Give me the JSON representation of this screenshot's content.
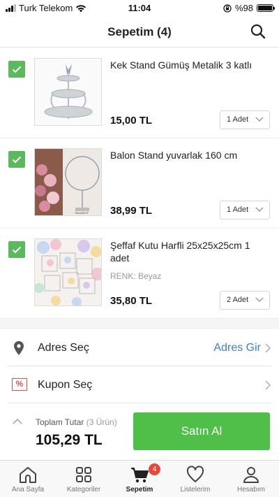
{
  "status_bar": {
    "carrier": "Turk Telekom",
    "time": "11:04",
    "battery": "%98",
    "battery_level": 0.98
  },
  "header": {
    "title": "Sepetim (4)",
    "search_icon": "search-icon"
  },
  "cart": {
    "items": [
      {
        "title": "Kek Stand Gümüş Metalik 3 katlı",
        "variant": "",
        "price": "15,00 TL",
        "quantity": "1 Adet",
        "checked": true
      },
      {
        "title": "Balon Stand yuvarlak 160 cm",
        "variant": "",
        "price": "38,99 TL",
        "quantity": "1 Adet",
        "checked": true,
        "image_caption": "75cm/29.5\""
      },
      {
        "title": "Şeffaf Kutu Harfli 25x25x25cm 1 adet",
        "variant": "RENK: Beyaz",
        "price": "35,80 TL",
        "quantity": "2 Adet",
        "checked": true
      }
    ]
  },
  "options": {
    "address": {
      "label": "Adres Seç",
      "action": "Adres Gir"
    },
    "coupon": {
      "label": "Kupon Seç",
      "icon_text": "%"
    }
  },
  "checkout": {
    "total_label": "Toplam Tutar",
    "item_count": "(3 Ürün)",
    "total_amount": "105,29 TL",
    "buy_label": "Satın Al"
  },
  "tabs": [
    {
      "label": "Ana Sayfa",
      "icon": "home-icon"
    },
    {
      "label": "Kategoriler",
      "icon": "grid-icon"
    },
    {
      "label": "Sepetim",
      "icon": "cart-icon",
      "badge": "4",
      "active": true
    },
    {
      "label": "Listelerim",
      "icon": "heart-icon"
    },
    {
      "label": "Hesabım",
      "icon": "user-icon"
    }
  ],
  "colors": {
    "check_green": "#5cb85c",
    "buy_green": "#4fbf4a",
    "link_blue": "#3b82c4",
    "badge_red": "#e8463b",
    "coupon_red": "#d9534f"
  }
}
